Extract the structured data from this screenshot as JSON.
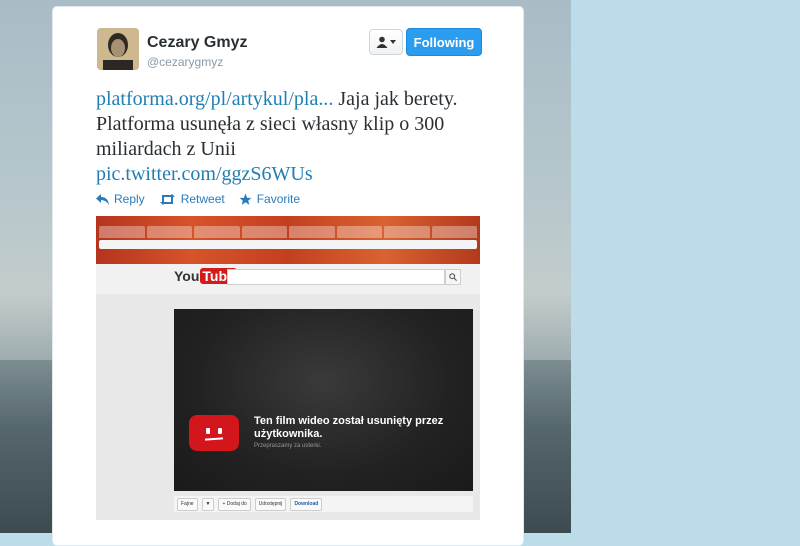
{
  "user": {
    "display_name": "Cezary Gmyz",
    "handle": "@cezarygmyz"
  },
  "follow_button": {
    "label": "Following"
  },
  "tweet": {
    "link1": "platforma.org/pl/artykul/pla...",
    "text": " Jaja jak berety. Platforma usunęła z sieci własny klip o 300 miliardach z Unii",
    "link2": "pic.twitter.com/ggzS6WUs"
  },
  "actions": {
    "reply": "Reply",
    "retweet": "Retweet",
    "favorite": "Favorite"
  },
  "media": {
    "logo_you": "You",
    "logo_tube": "Tube",
    "error_title": "Ten film wideo został usunięty przez użytkownika.",
    "error_sub": "Przepraszamy za usterki.",
    "toolbar": {
      "like": "Fajne",
      "add": "+ Dodaj do",
      "share": "Udostępnij",
      "download": "Download"
    }
  },
  "colors": {
    "follow_blue": "#2b9df0",
    "link_blue": "#1f7fb5",
    "action_blue": "#2b7bb9",
    "yt_red": "#d3161b"
  },
  "icons": [
    "user-icon",
    "chevron-down-icon",
    "reply-icon",
    "retweet-icon",
    "star-icon",
    "search-icon"
  ]
}
